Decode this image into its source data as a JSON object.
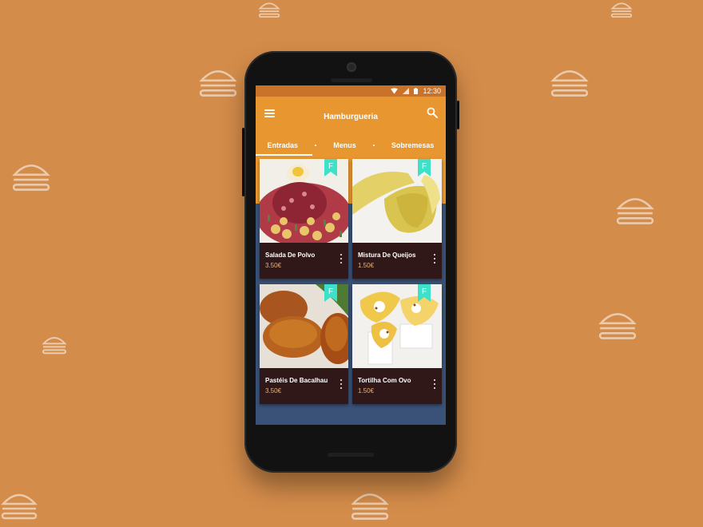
{
  "status_bar": {
    "time": "12:30"
  },
  "app_bar": {
    "title": "Hamburgueria"
  },
  "tabs": [
    {
      "label": "Entradas",
      "active": true
    },
    {
      "label": "Menus",
      "active": false
    },
    {
      "label": "Sobremesas",
      "active": false
    }
  ],
  "items": [
    {
      "name": "Salada De Polvo",
      "price": "3.50€",
      "badge": "F"
    },
    {
      "name": "Mistura De Queijos",
      "price": "1.50€",
      "badge": "F"
    },
    {
      "name": "Pastéis De Bacalhau",
      "price": "3.50€",
      "badge": "F"
    },
    {
      "name": "Tortilha Com Ovo",
      "price": "1.50€",
      "badge": "F"
    }
  ],
  "colors": {
    "background": "#d48c4a",
    "app_bar": "#e8962f",
    "status_bar": "#c9722a",
    "screen_bg": "#3a5277",
    "card_bg": "#301818",
    "ribbon": "#3de0c8",
    "price": "#e8b27a"
  }
}
